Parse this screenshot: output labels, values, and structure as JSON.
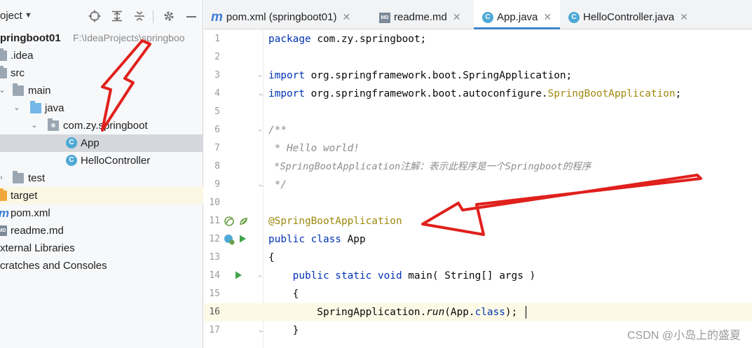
{
  "project_panel": {
    "title": "oject",
    "tree": [
      {
        "label": "pringboot01",
        "path": "F:\\IdeaProjects\\springboo"
      },
      {
        "label": ".idea"
      },
      {
        "label": "src"
      },
      {
        "label": "main"
      },
      {
        "label": "java"
      },
      {
        "label": "com.zy.springboot"
      },
      {
        "label": "App"
      },
      {
        "label": "HelloController"
      },
      {
        "label": "test"
      },
      {
        "label": "target"
      },
      {
        "label": "pom.xml"
      },
      {
        "label": "readme.md"
      },
      {
        "label": "xternal Libraries"
      },
      {
        "label": "cratches and Consoles"
      }
    ]
  },
  "tabs": [
    {
      "label": "pom.xml (springboot01)",
      "icon": "maven-icon"
    },
    {
      "label": "readme.md",
      "icon": "markdown-icon"
    },
    {
      "label": "App.java",
      "icon": "class-icon"
    },
    {
      "label": "HelloController.java",
      "icon": "class-icon"
    }
  ],
  "editor": {
    "line_numbers": [
      "1",
      "2",
      "3",
      "4",
      "5",
      "6",
      "7",
      "8",
      "9",
      "10",
      "11",
      "12",
      "13",
      "14",
      "15",
      "16",
      "17"
    ],
    "lines": {
      "l1_kw": "package",
      "l1_rest": " com.zy.springboot;",
      "l3_kw": "import",
      "l3_rest": " org.springframework.boot.SpringApplication;",
      "l4_kw": "import",
      "l4_rest": " org.springframework.boot.autoconfigure.",
      "l4_ann": "SpringBootApplication",
      "l4_end": ";",
      "l6": "/**",
      "l7": " * Hello world!",
      "l8": " *SpringBootApplication注解：表示此程序是一个Springboot的程序",
      "l9": " */",
      "l11": "@SpringBootApplication",
      "l12_kw": "public class",
      "l12_rest": " App",
      "l13": "{",
      "l14_kw": "    public static void",
      "l14_rest": " main( String[] args )",
      "l15": "    {",
      "l16_a": "        SpringApplication.",
      "l16_run": "run",
      "l16_b": "(App.",
      "l16_kw": "class",
      "l16_c": ");",
      "l17": "    }"
    }
  },
  "watermark": "CSDN @小岛上的盛夏",
  "colors": {
    "annotation": "#9e880d",
    "keyword": "#0033b3",
    "comment": "#8c8c8c",
    "arrow": "#e0201c"
  }
}
